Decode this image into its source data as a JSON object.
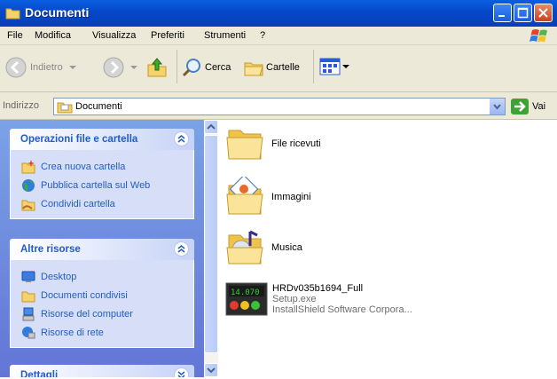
{
  "window": {
    "title": "Documenti"
  },
  "menu": [
    "File",
    "Modifica",
    "Visualizza",
    "Preferiti",
    "Strumenti",
    "?"
  ],
  "toolbar": {
    "back_label": "Indietro",
    "search_label": "Cerca",
    "folders_label": "Cartelle"
  },
  "address": {
    "label": "Indirizzo",
    "value": "Documenti",
    "go_label": "Vai"
  },
  "tasks": {
    "file_ops": {
      "title": "Operazioni file e cartella",
      "items": [
        {
          "label": "Crea nuova cartella",
          "icon": "new-folder-icon"
        },
        {
          "label": "Pubblica cartella sul Web",
          "icon": "globe-icon"
        },
        {
          "label": "Condividi cartella",
          "icon": "share-folder-icon"
        }
      ]
    },
    "other": {
      "title": "Altre risorse",
      "items": [
        {
          "label": "Desktop",
          "icon": "desktop-icon"
        },
        {
          "label": "Documenti condivisi",
          "icon": "shared-documents-icon"
        },
        {
          "label": "Risorse del computer",
          "icon": "my-computer-icon"
        },
        {
          "label": "Risorse di rete",
          "icon": "network-icon"
        }
      ]
    },
    "details": {
      "title": "Dettagli"
    }
  },
  "files": [
    {
      "name": "File ricevuti",
      "icon": "folder-icon"
    },
    {
      "name": "Immagini",
      "icon": "pictures-folder-icon"
    },
    {
      "name": "Musica",
      "icon": "music-folder-icon"
    },
    {
      "name": "HRDv035b1694_Full",
      "line2": "Setup.exe",
      "line3": "InstallShield Software Corpora...",
      "icon": "installer-icon"
    }
  ],
  "colors": {
    "title_bar": "#0a5fe0",
    "task_pane": "#6f8cdf",
    "link": "#215dc6",
    "chrome": "#ece9d8"
  }
}
